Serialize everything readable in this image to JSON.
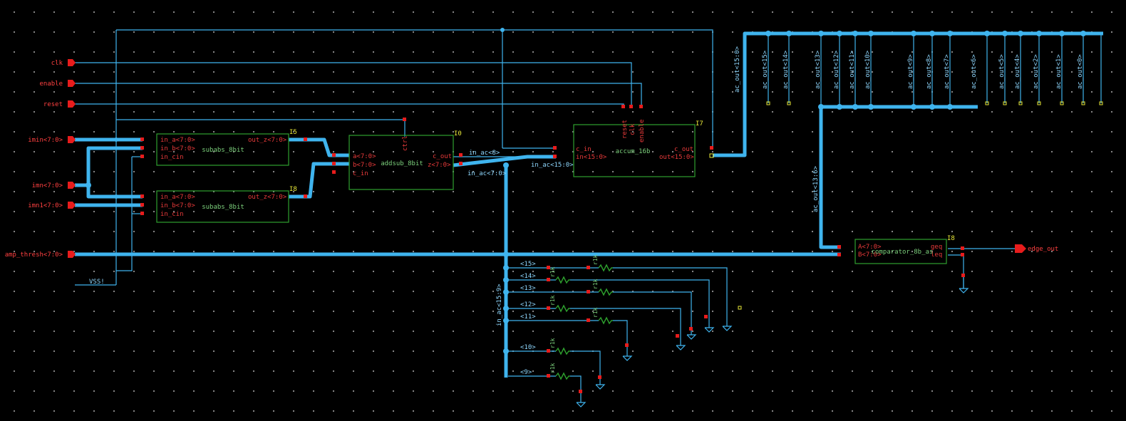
{
  "inputs": [
    {
      "label": "clk"
    },
    {
      "label": "enable"
    },
    {
      "label": "reset"
    },
    {
      "label": "imin<7:0>"
    },
    {
      "label": "imn<7:0>"
    },
    {
      "label": "imn1<7:0>"
    },
    {
      "label": "amp_thresh<7:0>"
    }
  ],
  "vss_label": "VSS!",
  "output_label": "edge_out",
  "blocks": {
    "subabs_top": {
      "name": "subabs_8bit",
      "inst": "I5",
      "pins_in": [
        "in_a<7:0>",
        "in_b<7:0>",
        "in_cin"
      ],
      "pin_out": "out_z<7:0>"
    },
    "subabs_bot": {
      "name": "subabs_8bit",
      "inst": "I8",
      "pins_in": [
        "in_a<7:0>",
        "in_b<7:0>",
        "in_cin"
      ],
      "pin_out": "out_z<7:0>"
    },
    "addsub": {
      "name": "addsub_8bit",
      "inst": "I0",
      "pins_in": [
        "a<7:0>",
        "b<7:0>",
        "c_in"
      ],
      "pins_out": [
        "c_out",
        "z<7:0>"
      ],
      "pin_top": "ctrl"
    },
    "accum": {
      "name": "accum_16b",
      "inst": "I7",
      "pins_in": [
        "c_in",
        "in<15:0>"
      ],
      "pins_out": [
        "c_out",
        "out<15:0>"
      ],
      "pins_top": [
        "reset",
        "clk",
        "enable"
      ]
    },
    "comparator": {
      "name": "comparator_8b_as",
      "inst": "I8",
      "pins_in": [
        "A<7:0>",
        "B<7:0>"
      ],
      "pins_out": [
        "geq",
        "leq"
      ]
    }
  },
  "wire_labels": {
    "in_ac8": "in_ac<8>",
    "in_ac70": "in_ac<7:0>",
    "in_ac150": "in_ac<15:0>",
    "in_ac159": "in_ac<15:9>",
    "ac_out150": "ac_out<15:0>",
    "ac_out136": "ac_out<13:6>"
  },
  "ac_outs": [
    "ac_out<15>",
    "ac_out<14>",
    "ac_out<13>",
    "ac_out<12>",
    "ac_out<11>",
    "ac_out<10>",
    "ac_out<9>",
    "ac_out<8>",
    "ac_out<7>",
    "ac_out<6>",
    "ac_out<5>",
    "ac_out<4>",
    "ac_out<2>",
    "ac_out<1>",
    "ac_out<0>"
  ],
  "resistor_taps": [
    "<15>",
    "<14>",
    "<13>",
    "<12>",
    "<11>",
    "<10>",
    "<9>"
  ],
  "resistor_label": "r1k",
  "colors": {
    "wire": "#3fb4ee",
    "pin": "#e81c1c",
    "block": "#2ea02e",
    "background": "#000000"
  }
}
